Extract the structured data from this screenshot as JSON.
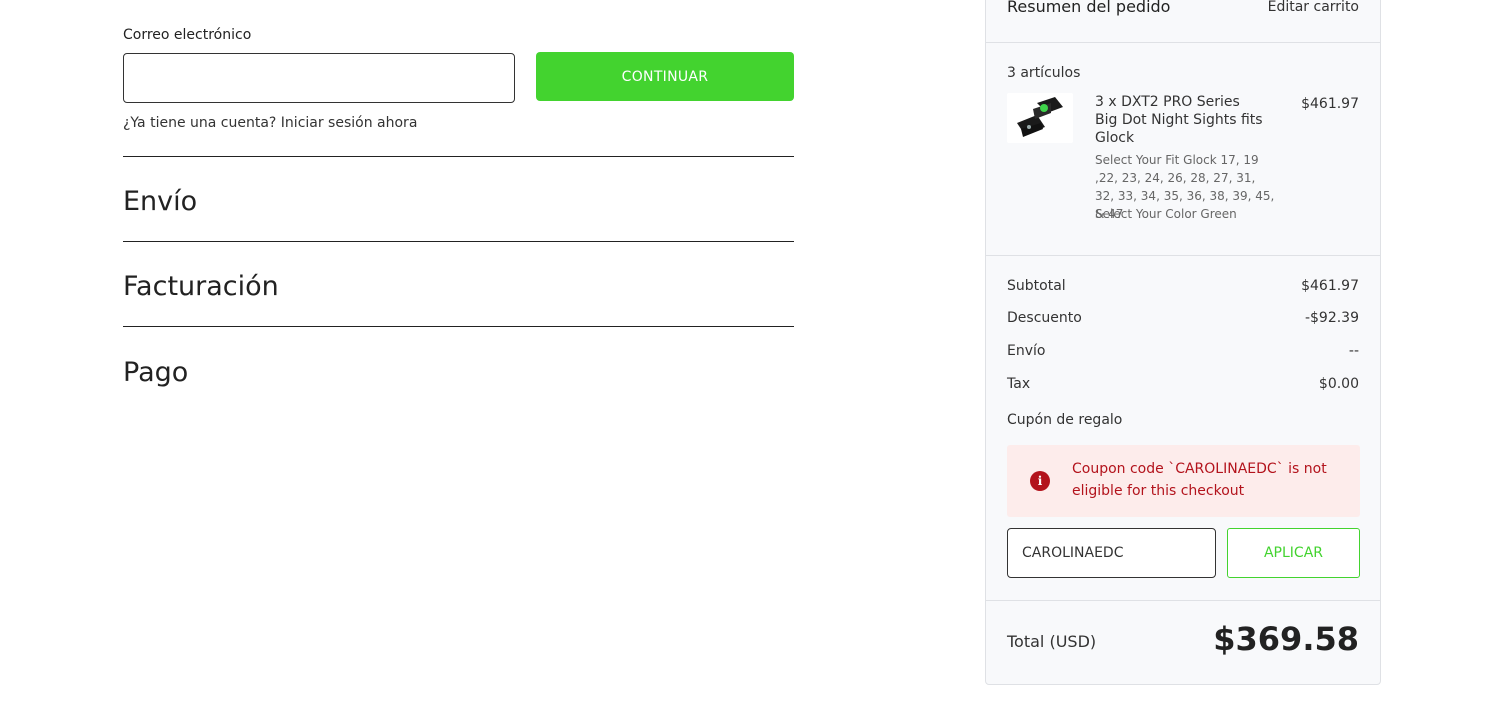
{
  "checkout": {
    "email_label": "Correo electrónico",
    "email_value": "",
    "continue_label": "CONTINUAR",
    "login_prompt": "¿Ya tiene una cuenta?",
    "login_link": "Iniciar sesión ahora",
    "sections": [
      "Envío",
      "Facturación",
      "Pago"
    ]
  },
  "summary": {
    "title": "Resumen del pedido",
    "edit_cart": "Editar carrito",
    "items_count": "3 artículos",
    "product": {
      "name": "3 x DXT2 PRO Series Big Dot Night Sights fits Glock",
      "price": "$461.97",
      "options": [
        "Select Your Fit Glock 17, 19 ,22, 23, 24, 26, 28, 27, 31, 32, 33, 34, 35, 36, 38, 39, 45, & 47",
        "Select Your Color Green"
      ],
      "image_icon": "gun-sight-product-image"
    },
    "rows": [
      {
        "label": "Subtotal",
        "value": "$461.97"
      },
      {
        "label": "Descuento",
        "value": "-$92.39"
      },
      {
        "label": "Envío",
        "value": "--"
      },
      {
        "label": "Tax",
        "value": "$0.00"
      }
    ],
    "coupon_label": "Cupón de regalo",
    "alert_text": "Coupon code `CAROLINAEDC` is not eligible for this checkout",
    "coupon_value": "CAROLINAEDC",
    "apply_label": "APLICAR",
    "total_label": "Total (USD)",
    "total_value": "$369.58"
  },
  "colors": {
    "accent_green": "#43d32f",
    "error_red": "#b3131c",
    "error_bg": "#fdeceb"
  }
}
